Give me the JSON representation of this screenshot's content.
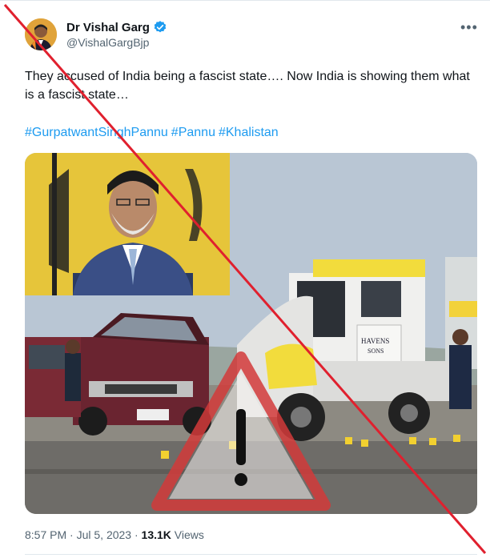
{
  "author": {
    "name": "Dr Vishal Garg",
    "handle": "@VishalGargBjp",
    "verified": true
  },
  "tweet": {
    "text": "They accused of India being a fascist state…. Now India is showing them what is a fascist state…",
    "hashtags": [
      "#GurpatwantSinghPannu",
      "#Pannu",
      "#Khalistan"
    ]
  },
  "media": {
    "truck_door_text": "HAVENS\nSONS",
    "inset_shows": "man in turban with yellow flag backdrop",
    "overlay_icon": "warning-triangle-icon"
  },
  "meta": {
    "time": "8:57 PM",
    "separator": "·",
    "date": "Jul 5, 2023",
    "views_count": "13.1K",
    "views_label": "Views"
  },
  "colors": {
    "link": "#1d9bf0",
    "secondary_text": "#536471",
    "verified": "#1d9bf0",
    "strike": "#e0202e"
  },
  "icons": [
    "verified-badge-icon",
    "more-options-icon",
    "warning-triangle-icon"
  ]
}
